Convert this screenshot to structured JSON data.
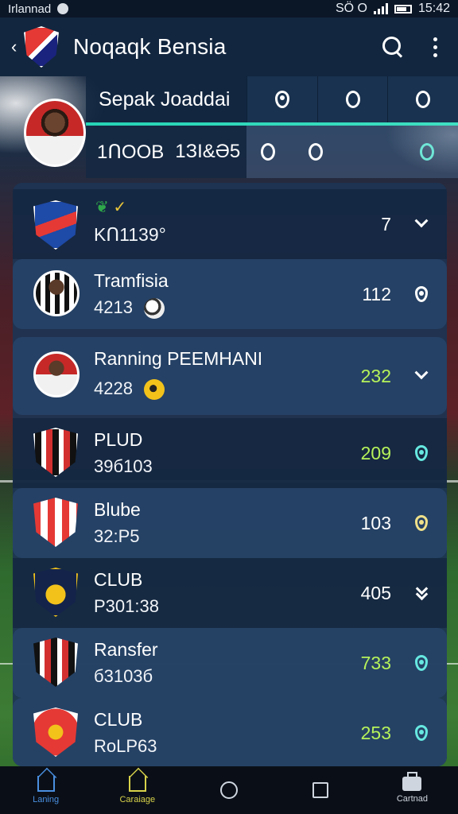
{
  "status_bar": {
    "left_text": "Irlannad",
    "right_text": "SÖ O",
    "time": "15:42"
  },
  "app_bar": {
    "title": "Noqaqk Bensia",
    "back_icon": "back-arrow-icon",
    "logo_icon": "club-crest-icon",
    "search_icon": "search-icon",
    "more_icon": "more-vertical-icon"
  },
  "profile": {
    "name": "Sepak Joaddai",
    "stats": [
      "1ՈOOB",
      "1ЗI&Ә5"
    ],
    "tabs": [
      "tab-1",
      "tab-2",
      "tab-3"
    ]
  },
  "list": [
    {
      "name": "",
      "sub": "KՈ1139°",
      "value": "7",
      "value_color": "white",
      "trail": "chevron-down-icon",
      "style": "dark",
      "crest": "crest-blue-red"
    },
    {
      "name": "Tramfisia",
      "sub": "4213",
      "value": "112",
      "value_color": "white",
      "trail": "pin-icon",
      "style": "hl",
      "crest": "player-avatar-1",
      "extra_icon": "soccer-ball-icon"
    },
    {
      "name": "Ranning PEEMHANI",
      "sub": "4228",
      "value": "232",
      "value_color": "green",
      "trail": "chevron-down-icon",
      "style": "hl",
      "crest": "player-avatar-2",
      "extra_icon": "gold-ball-icon"
    },
    {
      "name": "PLUD",
      "sub": "39б103",
      "value": "209",
      "value_color": "green",
      "trail": "pin-cyan-icon",
      "style": "dark",
      "crest": "crest-black-red"
    },
    {
      "name": "Blube",
      "sub": "32:P5",
      "value": "103",
      "value_color": "white",
      "trail": "pin-yellow-icon",
      "style": "hl",
      "crest": "crest-red-white"
    },
    {
      "name": "CLUB",
      "sub": "P301:38",
      "value": "405",
      "value_color": "white",
      "trail": "double-chevron-icon",
      "style": "dark",
      "crest": "crest-yellow-navy"
    },
    {
      "name": "Ransfer",
      "sub": "б3103б",
      "value": "733",
      "value_color": "green",
      "trail": "pin-cyan-icon",
      "style": "hl",
      "crest": "crest-black-red-2"
    },
    {
      "name": "CLUB",
      "sub": "RoLP63",
      "value": "253",
      "value_color": "green",
      "trail": "pin-cyan-icon",
      "style": "hl",
      "crest": "crest-red-gold"
    }
  ],
  "bottom_nav": [
    {
      "label": "Laning",
      "icon": "home-icon",
      "color": "#4a8fe0"
    },
    {
      "label": "Caraiage",
      "icon": "home-alt-icon",
      "color": "#d8d24a"
    },
    {
      "label": "",
      "icon": "circle-icon",
      "color": "#cfd5de"
    },
    {
      "label": "",
      "icon": "square-icon",
      "color": "#cfd5de"
    },
    {
      "label": "Cartnad",
      "icon": "bag-icon",
      "color": "#cfd5de"
    }
  ],
  "colors": {
    "accent_teal": "#25d3b4",
    "value_green": "#b6f25a",
    "card_bg": "#1c3452",
    "appbar_bg": "#12263f"
  }
}
